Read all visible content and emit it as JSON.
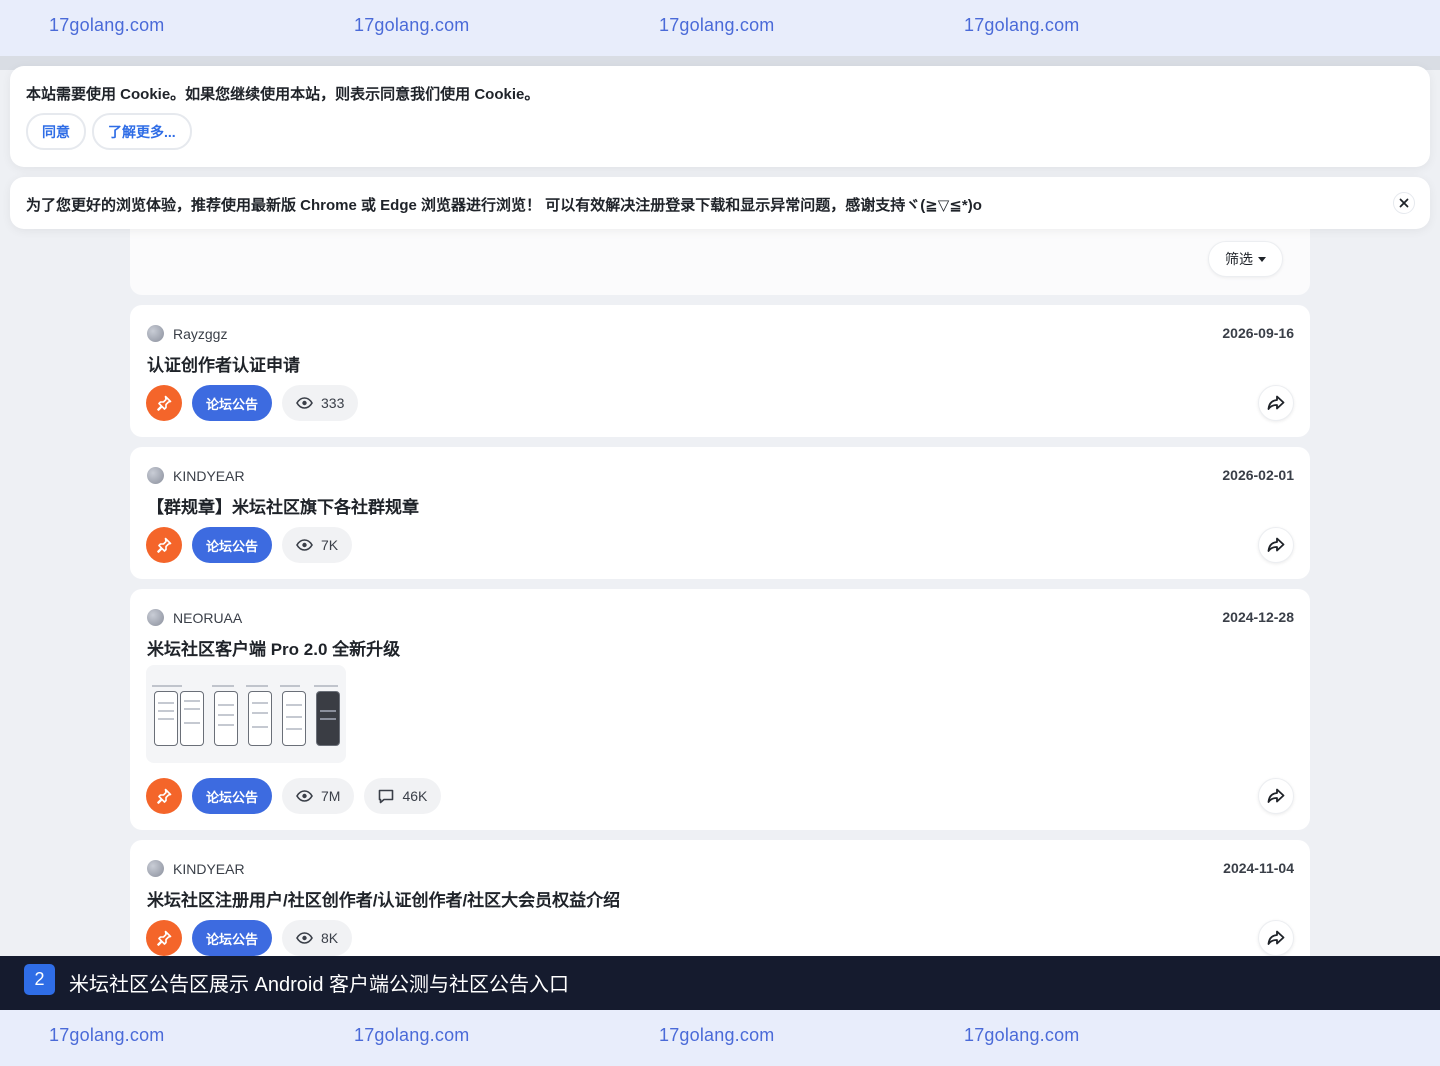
{
  "watermark": {
    "text": "17golang.com"
  },
  "cookie_banner": {
    "message": "本站需要使用 Cookie。如果您继续使用本站，则表示同意我们使用 Cookie。",
    "agree_label": "同意",
    "more_label": "了解更多..."
  },
  "browser_notice": {
    "message": "为了您更好的浏览体验，推荐使用最新版 Chrome 或 Edge 浏览器进行浏览！ 可以有效解决注册登录下载和显示异常问题，感谢支持ヾ(≧▽≦*)o"
  },
  "filter": {
    "label": "筛选"
  },
  "posts": [
    {
      "author": "Rayzggz",
      "date": "2026-09-16",
      "title": "认证创作者认证申请",
      "category": "论坛公告",
      "views": "333",
      "comments": ""
    },
    {
      "author": "KINDYEAR",
      "date": "2026-02-01",
      "title": "【群规章】米坛社区旗下各社群规章",
      "category": "论坛公告",
      "views": "7K",
      "comments": ""
    },
    {
      "author": "NEORUAA",
      "date": "2024-12-28",
      "title": "米坛社区客户端 Pro 2.0 全新升级",
      "category": "论坛公告",
      "views": "7M",
      "comments": "46K"
    },
    {
      "author": "KINDYEAR",
      "date": "2024-11-04",
      "title": "米坛社区注册用户/社区创作者/认证创作者/社区大会员权益介绍",
      "category": "论坛公告",
      "views": "8K",
      "comments": ""
    }
  ],
  "caption": {
    "number": "2",
    "text": "米坛社区公告区展示 Android 客户端公测与社区公告入口"
  },
  "icons": {
    "pin": "pin-icon",
    "views": "eye-icon",
    "comments": "comment-icon",
    "share": "share-icon",
    "close": "close-icon",
    "caret": "caret-down-icon"
  },
  "colors": {
    "watermark_bg": "#e8edfb",
    "watermark_text": "#4a6ad8",
    "pin_orange": "#f4652a",
    "category_blue": "#3d6be0",
    "link_blue": "#2f6de6",
    "caption_bg": "#151b2e"
  }
}
